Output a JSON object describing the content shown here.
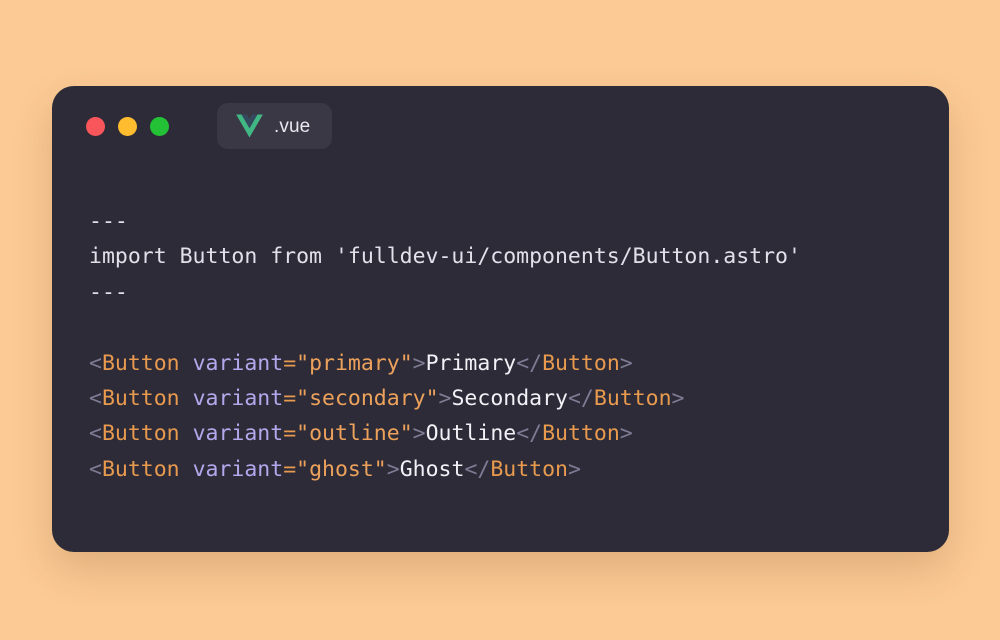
{
  "window": {
    "traffic_lights": [
      {
        "name": "close",
        "color": "#f9565b"
      },
      {
        "name": "minimize",
        "color": "#febc2e"
      },
      {
        "name": "maximize",
        "color": "#23c136"
      }
    ],
    "file_tab": {
      "icon": "vue-logo-icon",
      "label": ".vue",
      "icon_colors": {
        "outer": "#41b883",
        "inner": "#34495e"
      }
    },
    "background_color": "#2d2b38",
    "page_background_color": "#fcca94"
  },
  "code": {
    "language": "astro",
    "lines": [
      {
        "id": "line-1",
        "tokens": [
          {
            "text": "---",
            "type": "plain"
          }
        ]
      },
      {
        "id": "line-2",
        "tokens": [
          {
            "text": "import Button from 'fulldev-ui/components/Button.astro'",
            "type": "plain"
          }
        ]
      },
      {
        "id": "line-3",
        "tokens": [
          {
            "text": "---",
            "type": "plain"
          }
        ]
      },
      {
        "id": "line-4",
        "tokens": []
      },
      {
        "id": "line-5",
        "tokens": [
          {
            "text": "<",
            "type": "punct"
          },
          {
            "text": "Button",
            "type": "tag"
          },
          {
            "text": " ",
            "type": "plain"
          },
          {
            "text": "variant",
            "type": "attr"
          },
          {
            "text": "=",
            "type": "eq"
          },
          {
            "text": "\"primary\"",
            "type": "string"
          },
          {
            "text": ">",
            "type": "punct"
          },
          {
            "text": "Primary",
            "type": "text"
          },
          {
            "text": "</",
            "type": "punct"
          },
          {
            "text": "Button",
            "type": "tag"
          },
          {
            "text": ">",
            "type": "punct"
          }
        ]
      },
      {
        "id": "line-6",
        "tokens": [
          {
            "text": "<",
            "type": "punct"
          },
          {
            "text": "Button",
            "type": "tag"
          },
          {
            "text": " ",
            "type": "plain"
          },
          {
            "text": "variant",
            "type": "attr"
          },
          {
            "text": "=",
            "type": "eq"
          },
          {
            "text": "\"secondary\"",
            "type": "string"
          },
          {
            "text": ">",
            "type": "punct"
          },
          {
            "text": "Secondary",
            "type": "text"
          },
          {
            "text": "</",
            "type": "punct"
          },
          {
            "text": "Button",
            "type": "tag"
          },
          {
            "text": ">",
            "type": "punct"
          }
        ]
      },
      {
        "id": "line-7",
        "tokens": [
          {
            "text": "<",
            "type": "punct"
          },
          {
            "text": "Button",
            "type": "tag"
          },
          {
            "text": " ",
            "type": "plain"
          },
          {
            "text": "variant",
            "type": "attr"
          },
          {
            "text": "=",
            "type": "eq"
          },
          {
            "text": "\"outline\"",
            "type": "string"
          },
          {
            "text": ">",
            "type": "punct"
          },
          {
            "text": "Outline",
            "type": "text"
          },
          {
            "text": "</",
            "type": "punct"
          },
          {
            "text": "Button",
            "type": "tag"
          },
          {
            "text": ">",
            "type": "punct"
          }
        ]
      },
      {
        "id": "line-8",
        "tokens": [
          {
            "text": "<",
            "type": "punct"
          },
          {
            "text": "Button",
            "type": "tag"
          },
          {
            "text": " ",
            "type": "plain"
          },
          {
            "text": "variant",
            "type": "attr"
          },
          {
            "text": "=",
            "type": "eq"
          },
          {
            "text": "\"ghost\"",
            "type": "string"
          },
          {
            "text": ">",
            "type": "punct"
          },
          {
            "text": "Ghost",
            "type": "text"
          },
          {
            "text": "</",
            "type": "punct"
          },
          {
            "text": "Button",
            "type": "tag"
          },
          {
            "text": ">",
            "type": "punct"
          }
        ]
      }
    ]
  }
}
